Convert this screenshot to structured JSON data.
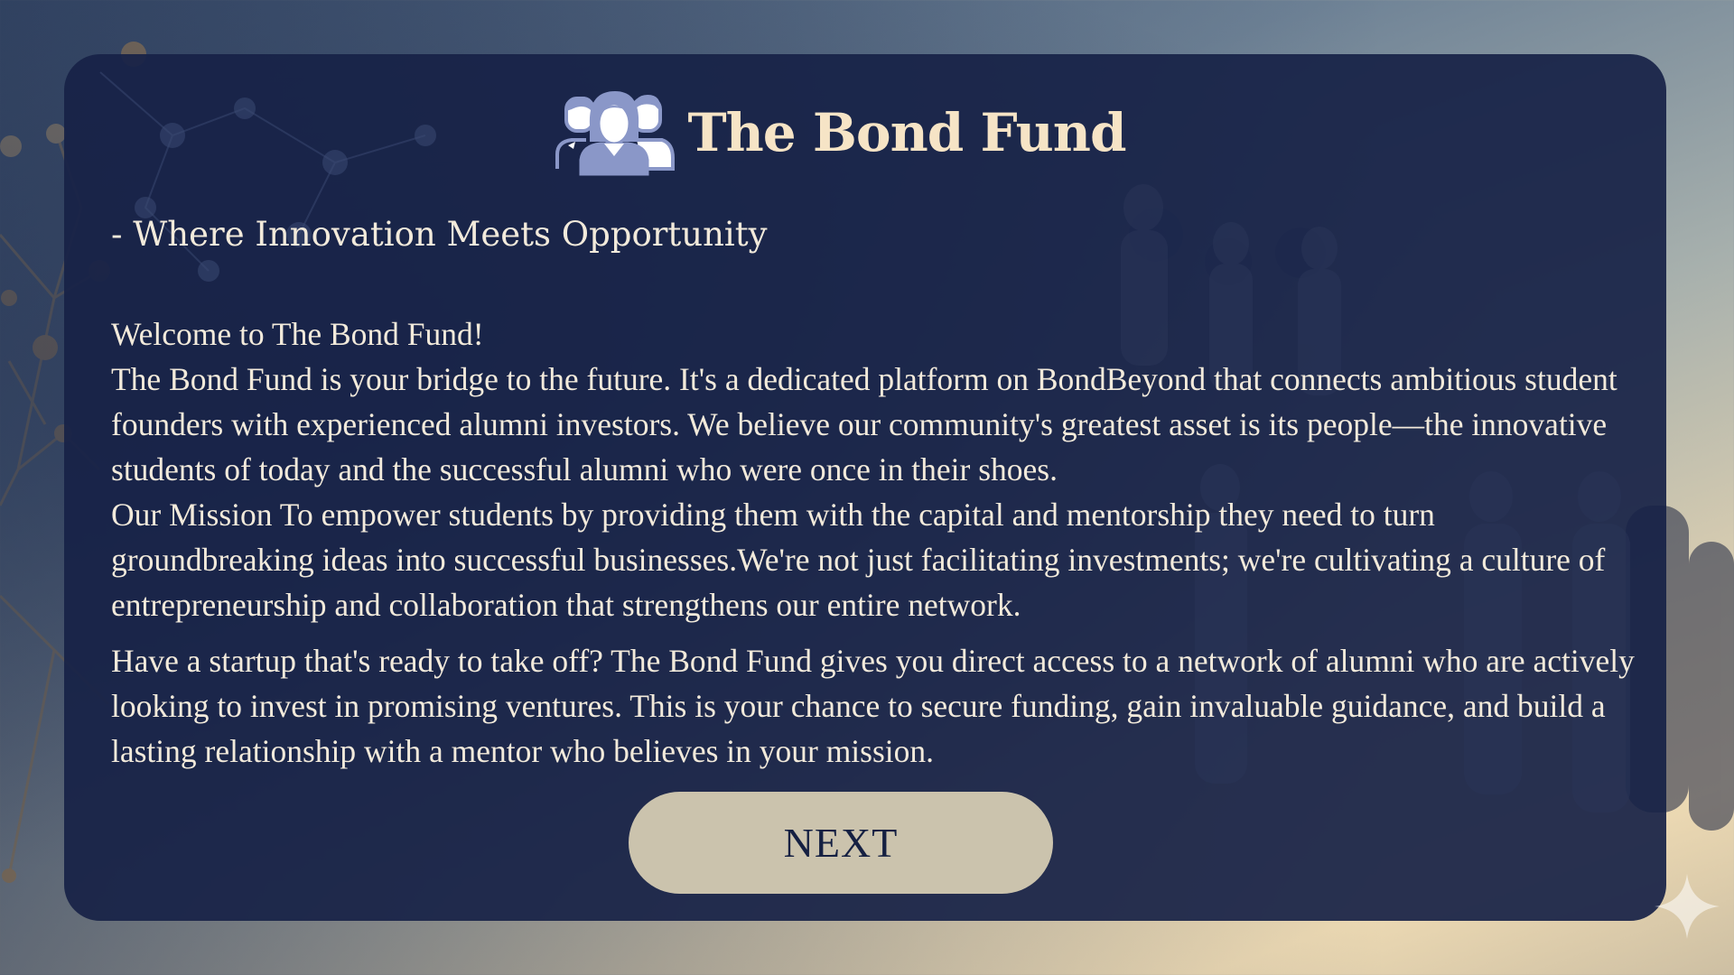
{
  "header": {
    "title": "The Bond Fund",
    "logo_icon": "people-group-icon"
  },
  "tagline": "- Where Innovation Meets Opportunity",
  "content": {
    "welcome": "Welcome to The Bond Fund!",
    "intro": "The Bond Fund is your bridge to the future. It's a dedicated platform on BondBeyond that connects ambitious student founders with experienced alumni investors. We believe our community's greatest asset is its people—the innovative students of today and the successful alumni who were once in their shoes.",
    "mission": "Our Mission To empower students by providing them with the capital and mentorship they need to turn groundbreaking ideas into successful businesses.We're not just facilitating investments; we're cultivating a culture of entrepreneurship and collaboration that strengthens our entire network.",
    "startup": "Have a startup that's ready to take off? The Bond Fund gives you direct access to a network of alumni who are actively looking to invest in promising ventures. This is your chance to secure funding, gain invaluable guidance, and build a lasting relationship with a mentor who believes in your mission."
  },
  "actions": {
    "next_label": "NEXT"
  },
  "colors": {
    "panel": "#172246",
    "title": "#f6e4c6",
    "text": "#f2eadb",
    "button": "#cbc3ad",
    "button_text": "#152042"
  }
}
